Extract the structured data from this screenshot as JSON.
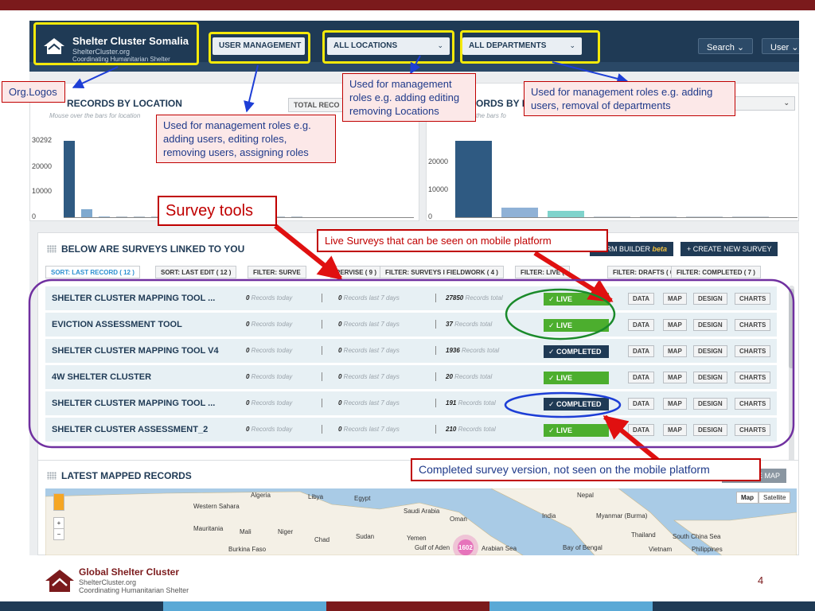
{
  "colors": {
    "brand_red": "#7b1a1c",
    "navy": "#1f3a55",
    "live_green": "#4cae2e",
    "annotation_red": "#c00000",
    "highlight_yellow": "#f5e90a"
  },
  "header": {
    "logo_title": "Shelter Cluster Somalia",
    "logo_site": "ShelterCluster.org",
    "logo_tagline": "Coordinating Humanitarian Shelter",
    "user_management": "USER MANAGEMENT",
    "locations": "ALL LOCATIONS",
    "departments": "ALL DEPARTMENTS",
    "search": "Search",
    "user": "User"
  },
  "records_by_location": {
    "title": "RECORDS BY LOCATION",
    "hint": "Mouse over the bars for location",
    "total_button": "TOTAL RECO",
    "chart_data": {
      "type": "bar",
      "title": "RECORDS BY LOCATION",
      "y_ticks": [
        "30292",
        "20000",
        "10000",
        "0"
      ],
      "ylim": [
        0,
        30292
      ],
      "values": [
        30292,
        3200,
        300,
        250,
        200,
        200,
        200,
        150,
        150,
        150,
        150,
        120,
        120,
        100
      ]
    }
  },
  "records_by_department": {
    "title": "ORDS BY D",
    "hint": "the bars fo",
    "chart_data": {
      "type": "bar",
      "title": "ORDS BY D",
      "y_ticks": [
        "20000",
        "10000",
        "0"
      ],
      "ylim": [
        0,
        28000
      ],
      "values": [
        28000,
        3500,
        2200,
        200,
        250,
        200,
        180
      ]
    }
  },
  "surveys": {
    "title": "BELOW ARE SURVEYS LINKED TO YOU",
    "form_builder": "FORM BUILDER",
    "beta": "beta",
    "create_new": "CREATE NEW SURVEY",
    "tabs": [
      "SORT: LAST RECORD ( 12 )",
      "SORT: LAST EDIT ( 12 )",
      "FILTER: SURVE",
      "PERVISE ( 9 )",
      "FILTER: SURVEYS I FIELDWORK ( 4 )",
      "FILTER: LIVE (",
      "FILTER: DRAFTS ( 0 )",
      "FILTER: COMPLETED ( 7 )"
    ],
    "today_label": "Records today",
    "week_label": "Records last 7 days",
    "total_label": "Records total",
    "actions": [
      "DATA",
      "MAP",
      "DESIGN",
      "CHARTS"
    ],
    "rows": [
      {
        "name": "SHELTER CLUSTER MAPPING TOOL ...",
        "today": "0",
        "week": "0",
        "total": "27850",
        "status": "✓ LIVE"
      },
      {
        "name": "EVICTION ASSESSMENT TOOL",
        "today": "0",
        "week": "0",
        "total": "37",
        "status": "✓ LIVE"
      },
      {
        "name": "SHELTER CLUSTER MAPPING TOOL V4",
        "today": "0",
        "week": "0",
        "total": "1936",
        "status": "✓ COMPLETED"
      },
      {
        "name": "4W SHELTER CLUSTER",
        "today": "0",
        "week": "0",
        "total": "20",
        "status": "✓ LIVE"
      },
      {
        "name": "SHELTER CLUSTER MAPPING TOOL ...",
        "today": "0",
        "week": "0",
        "total": "191",
        "status": "✓ COMPLETED"
      },
      {
        "name": "SHELTER CLUSTER ASSESSMENT_2",
        "today": "0",
        "week": "0",
        "total": "210",
        "status": "✓ LIVE"
      }
    ]
  },
  "latest": {
    "title": "LATEST MAPPED RECORDS",
    "full_map": "ULL PAGE MAP",
    "map_btn": "Map",
    "satellite_btn": "Satellite",
    "marker_count": "1602",
    "places": [
      "Western Sahara",
      "Algeria",
      "Libya",
      "Egypt",
      "Saudi Arabia",
      "Oman",
      "Yemen",
      "Gulf of Aden",
      "Arabian Sea",
      "Mauritania",
      "Mali",
      "Niger",
      "Chad",
      "Sudan",
      "Burkina Faso",
      "India",
      "Nepal",
      "Myanmar (Burma)",
      "Bay of Bengal",
      "Thailand",
      "South China Sea",
      "Vietnam",
      "Philippines"
    ]
  },
  "annotations": {
    "org_logos": "Org.Logos",
    "user_mgmt": "Used for management roles e.g. adding users, editing roles,  removing users, assigning roles",
    "locations": "Used for management roles e.g. adding  editing removing Locations",
    "departments": "Used for management roles e.g. adding users, removal of departments",
    "survey_tools": "Survey tools",
    "live_surveys": "Live Surveys that can be seen on mobile platform",
    "completed": "Completed survey version, not seen on the mobile platform"
  },
  "footer": {
    "org": "Global Shelter Cluster",
    "site": "ShelterCluster.org",
    "tagline": "Coordinating Humanitarian Shelter",
    "page": "4"
  }
}
